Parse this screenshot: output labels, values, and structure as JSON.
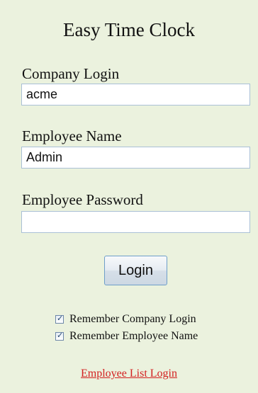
{
  "app": {
    "title": "Easy Time Clock"
  },
  "form": {
    "company_login": {
      "label": "Company Login",
      "value": "acme"
    },
    "employee_name": {
      "label": "Employee Name",
      "value": "Admin"
    },
    "employee_password": {
      "label": "Employee Password",
      "value": ""
    },
    "login_button_label": "Login",
    "remember_company": {
      "label": "Remember Company Login",
      "checked": true
    },
    "remember_employee": {
      "label": "Remember Employee Name",
      "checked": true
    }
  },
  "links": {
    "employee_list_login": "Employee List Login"
  },
  "colors": {
    "background": "#ebf2de",
    "link": "#d32020",
    "input_border": "#a9c0d6"
  }
}
